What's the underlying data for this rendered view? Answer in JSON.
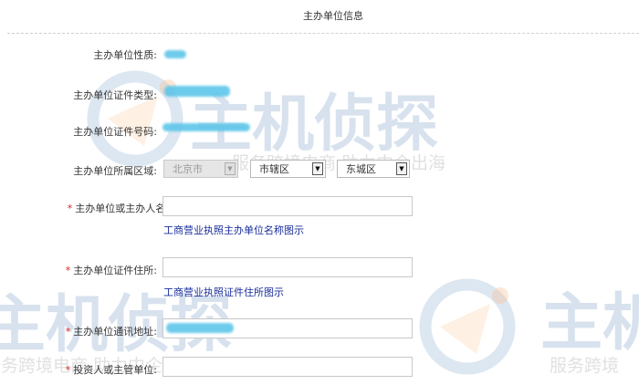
{
  "section": {
    "title": "主办单位信息"
  },
  "form": {
    "org_nature_label": "主办单位性质:",
    "org_cert_type_label": "主办单位证件类型:",
    "org_cert_number_label": "主办单位证件号码:",
    "org_region_label": "主办单位所属区域:",
    "region": {
      "city": "北京市",
      "district": "市辖区",
      "county": "东城区"
    },
    "org_name_label": "主办单位或主办人名称:",
    "org_name_value": "",
    "org_name_hint": "工商营业执照主办单位名称图示",
    "org_address_label": "主办单位证件住所:",
    "org_address_value": "",
    "org_address_hint": "工商营业执照证件住所图示",
    "org_mail_address_label": "主办单位通讯地址:",
    "investor_label": "投资人或主管单位:",
    "investor_value": "",
    "required_mark": "*"
  },
  "watermark": {
    "brand": "主机侦探",
    "slogan": "服务跨境电商 助力中企出海",
    "brand_partial": "主机",
    "slogan_partial": "服务跨境"
  },
  "colors": {
    "required": "#e02020",
    "hint_link": "#1a2f9a",
    "redaction": "#5ec6ea"
  }
}
